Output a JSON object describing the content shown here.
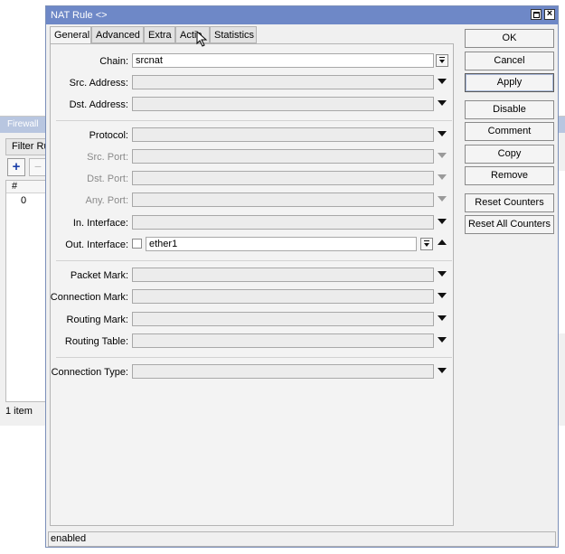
{
  "background_window": {
    "title": "Firewall",
    "tab": "Filter Rul",
    "column_hash": "#",
    "row_number": "0",
    "status": "1 item"
  },
  "dialog": {
    "title": "NAT Rule <>",
    "tabs": [
      "General",
      "Advanced",
      "Extra",
      "Actio",
      "Statistics"
    ],
    "active_tab": "General",
    "fields": {
      "chain": {
        "label": "Chain:",
        "value": "srcnat"
      },
      "src_address": {
        "label": "Src. Address:"
      },
      "dst_address": {
        "label": "Dst. Address:"
      },
      "protocol": {
        "label": "Protocol:"
      },
      "src_port": {
        "label": "Src. Port:"
      },
      "dst_port": {
        "label": "Dst. Port:"
      },
      "any_port": {
        "label": "Any. Port:"
      },
      "in_interface": {
        "label": "In. Interface:"
      },
      "out_interface": {
        "label": "Out. Interface:",
        "value": "ether1"
      },
      "packet_mark": {
        "label": "Packet Mark:"
      },
      "connection_mark": {
        "label": "Connection Mark:"
      },
      "routing_mark": {
        "label": "Routing Mark:"
      },
      "routing_table": {
        "label": "Routing Table:"
      },
      "connection_type": {
        "label": "Connection Type:"
      }
    },
    "buttons": {
      "ok": "OK",
      "cancel": "Cancel",
      "apply": "Apply",
      "disable": "Disable",
      "comment": "Comment",
      "copy": "Copy",
      "remove": "Remove",
      "reset_counters": "Reset Counters",
      "reset_all_counters": "Reset All Counters"
    },
    "status": "enabled"
  },
  "colors": {
    "title_bar": "#6e88c7",
    "background_title": "#b8c6e0",
    "add_icon": "#1b3fa8"
  },
  "icons": [
    "plus-icon",
    "minus-icon",
    "maximize-icon",
    "close-icon",
    "dropdown-arrow-icon",
    "cursor-icon"
  ]
}
